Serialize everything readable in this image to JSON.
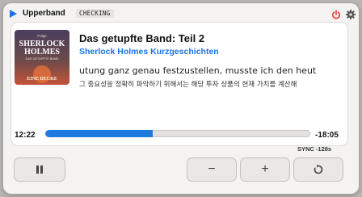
{
  "app": {
    "name": "Upperband",
    "status_badge": "CHECKING"
  },
  "episode": {
    "title": "Das getupfte Band: Teil 2",
    "show": "Sherlock Holmes Kurzgeschichten"
  },
  "cover": {
    "line1": "SHERLOCK",
    "line2": "HOLMES",
    "line3": "DAS GETUPFTE BAND",
    "line4": "Folge",
    "line5": "EINE DECKE"
  },
  "ticker": {
    "line1": "utung ganz genau festzustellen, musste ich den heut",
    "line2": "그 중요성을 정확히 파악하기 위해서는 해당 투자 상품의 현재 가치를 계산해"
  },
  "playback": {
    "elapsed": "12:22",
    "remaining": "-18:05",
    "progress": 0.406,
    "sync": "SYNC -128s"
  },
  "controls": {
    "pause": "pause",
    "minus": "−",
    "plus": "+",
    "repeat": "repeat"
  },
  "colors": {
    "accent": "#1a73e8",
    "power": "#e53935"
  }
}
